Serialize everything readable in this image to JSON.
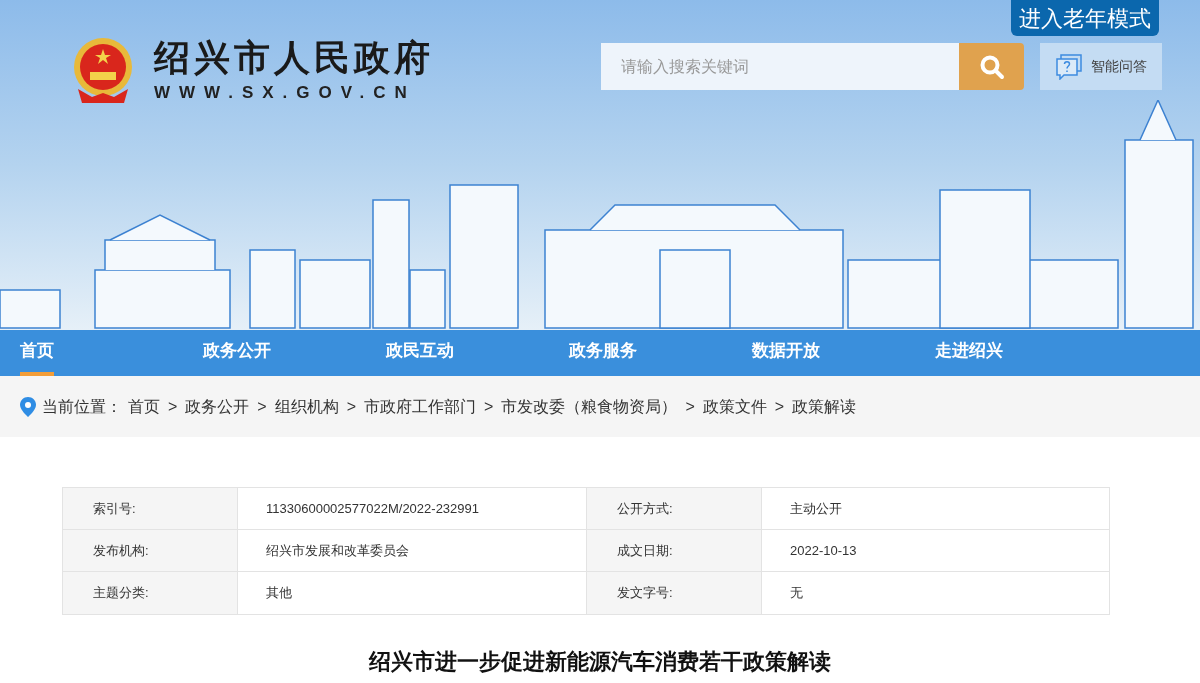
{
  "header": {
    "site_name": "绍兴市人民政府",
    "site_url": "WWW.SX.GOV.CN",
    "elder_mode": "进入老年模式",
    "search": {
      "placeholder": "请输入搜索关键词"
    },
    "qa": "智能问答"
  },
  "nav": [
    {
      "label": "首页",
      "selected": true
    },
    {
      "label": "政务公开",
      "selected": false
    },
    {
      "label": "政民互动",
      "selected": false
    },
    {
      "label": "政务服务",
      "selected": false
    },
    {
      "label": "数据开放",
      "selected": false
    },
    {
      "label": "走进绍兴",
      "selected": false
    }
  ],
  "breadcrumb": {
    "label": "当前位置：",
    "separator": ">",
    "items": [
      "首页",
      "政务公开",
      "组织机构",
      "市政府工作部门",
      "市发改委（粮食物资局）",
      "政策文件",
      "政策解读"
    ]
  },
  "info_table": {
    "rows": [
      [
        {
          "label": "索引号:",
          "value": "11330600002577022M/2022-232991"
        },
        {
          "label": "公开方式:",
          "value": "主动公开"
        }
      ],
      [
        {
          "label": "发布机构:",
          "value": "绍兴市发展和改革委员会"
        },
        {
          "label": "成文日期:",
          "value": "2022-10-13"
        }
      ],
      [
        {
          "label": "主题分类:",
          "value": "其他"
        },
        {
          "label": "发文字号:",
          "value": "无"
        }
      ]
    ]
  },
  "article": {
    "title": "绍兴市进一步促进新能源汽车消费若干政策解读"
  }
}
